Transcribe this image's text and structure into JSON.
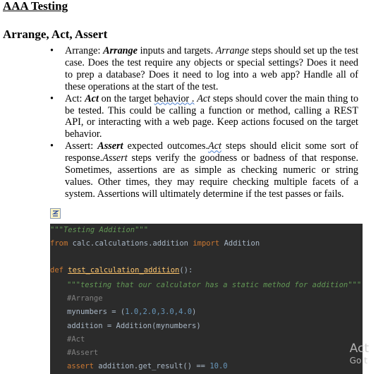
{
  "document": {
    "title": "AAA Testing",
    "section_heading": "Arrange, Act, Assert",
    "bullet_char": "•",
    "bullets": [
      {
        "label": "Arrange:",
        "term": "Arrange",
        "text_1": " inputs and targets. ",
        "term_2": "Arrange",
        "text_2": " steps should set up the test case. Does the test require any objects or special settings? Does it need to prep a database? Does it need to log into a web app? Handle all of these operations at the start of the test."
      },
      {
        "label": "Act:",
        "term": "Act",
        "text_1": " on the target ",
        "link_text": "behavior .",
        "term_2": "Act",
        "text_2": " steps should cover the main thing to be tested. This could be calling a function or method, calling a REST API, or interacting with a web page. Keep actions focused on the target behavior."
      },
      {
        "label": "Assert:",
        "term": "Assert",
        "text_1": " expected outcomes.",
        "term_2": "Act",
        "text_2": " steps should elicit some sort of response.",
        "term_3": "Assert",
        "text_3": " steps verify the goodness or badness of that response. Sometimes, assertions are as simple as checking numeric or string values. Other times, they may require checking multiple facets of a system. Assertions will ultimately determine if the test passes or fails."
      }
    ]
  },
  "code": {
    "line1": "\"\"\"Testing Addition\"\"\"",
    "line2_kw1": "from",
    "line2_mod": " calc.calculations.addition ",
    "line2_kw2": "import",
    "line2_name": " Addition",
    "line3_kw": "def",
    "line3_fn": "test_calculation_addition",
    "line3_rest": "():",
    "line4": "\"\"\"testing that our calculator has a static method for addition\"\"\"",
    "line5": "#Arrange",
    "line6_var": "mynumbers",
    "line6_eq": " = (",
    "line6_nums": "1.0,2.0,3.0,4.0",
    "line6_close": ")",
    "line7": "addition = Addition(mynumbers)",
    "line8": "#Act",
    "line9": "#Assert",
    "line10_kw": "assert",
    "line10_expr": " addition.get_result() == ",
    "line10_num": "10.0"
  },
  "watermark": {
    "line1": "Act",
    "line2": "Go t"
  }
}
